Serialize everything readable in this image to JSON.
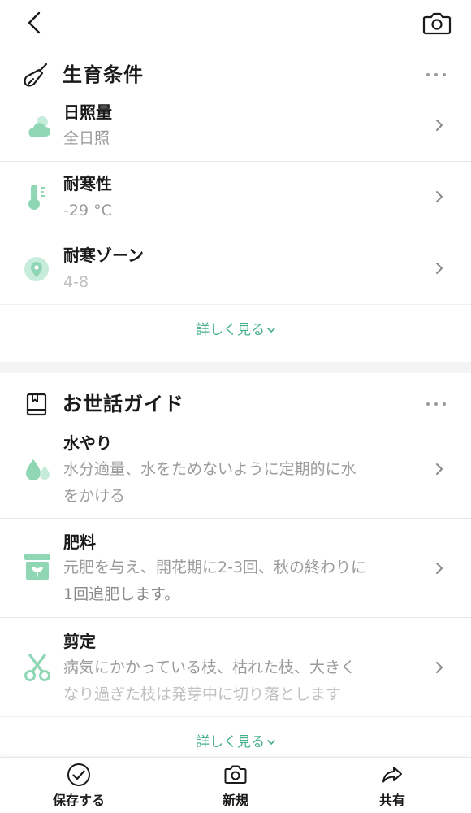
{
  "top_bar": {
    "back_icon": "chevron-left-icon",
    "camera_icon": "camera-icon"
  },
  "colors": {
    "accent": "#46b08a",
    "icon_green": "#8fd6b5",
    "muted_text": "#9b9b9b",
    "divider": "#e6e6e6",
    "band": "#f3f5f4"
  },
  "growth": {
    "title": "生育条件",
    "icon": "trowel-icon",
    "items": [
      {
        "title": "日照量",
        "value": "全日照",
        "icon": "cloud-sun-icon"
      },
      {
        "title": "耐寒性",
        "value": "-29 °C",
        "icon": "thermometer-icon"
      },
      {
        "title": "耐寒ゾーン",
        "value": "4-8",
        "icon": "location-pin-icon"
      }
    ],
    "see_more": "詳しく見る"
  },
  "care": {
    "title": "お世話ガイド",
    "icon": "book-icon",
    "items": [
      {
        "title": "水やり",
        "line1": "水分適量、水をためないように定期的に水",
        "line2": "をかける",
        "icon": "water-drops-icon"
      },
      {
        "title": "肥料",
        "line1": "元肥を与え、開花期に2-3回、秋の終わりに",
        "line2": "1回追肥します。",
        "icon": "fertilizer-icon"
      },
      {
        "title": "剪定",
        "line1": "病気にかかっている枝、枯れた枝、大きく",
        "line2": "なり過ぎた枝は発芽中に切り落とします",
        "icon": "scissors-icon"
      }
    ],
    "see_more": "詳しく見る"
  },
  "bottom_bar": {
    "save": {
      "label": "保存する",
      "icon": "check-circle-icon"
    },
    "new": {
      "label": "新規",
      "icon": "camera-icon"
    },
    "share": {
      "label": "共有",
      "icon": "share-icon"
    }
  }
}
